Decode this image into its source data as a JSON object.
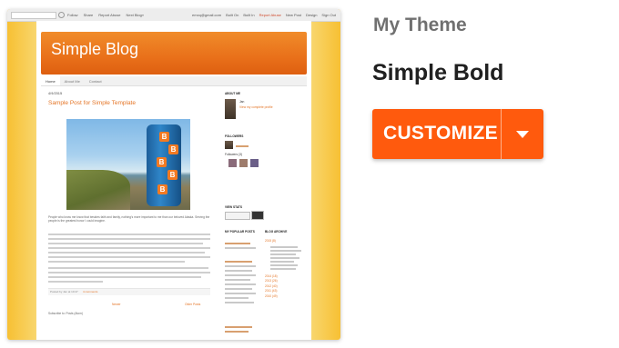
{
  "theme_panel": {
    "section_label": "My Theme",
    "theme_name": "Simple Bold",
    "customize_label": "CUSTOMIZE",
    "dropdown_icon": "caret-down-icon",
    "accent_color": "#ff5a0d"
  },
  "preview": {
    "navbar": {
      "links_left": [
        "Follow",
        "Share",
        "Report Abuse",
        "Next Blog»"
      ],
      "email": "emxq@gmail.com",
      "links_right": [
        "Built On",
        "Built In",
        "Report Abuse",
        "New Post",
        "Design",
        "Sign Out"
      ]
    },
    "blog_title": "Simple Blog",
    "tabs": [
      "Home",
      "About Me",
      "Contact"
    ],
    "post": {
      "date": "4/9/2015",
      "title": "Sample Post for Simple Template",
      "body_intro": "People who know me know that besides faith and family, nothing's more important to me than our beloved Alaska. Serving the people is the greatest honor I could imagine.",
      "posted_by": "Posted by Jan at 10:47",
      "comments": "4 comments",
      "newer": "Newer",
      "older": "Older Posts",
      "subscribe": "Subscribe to: Posts (Atom)"
    },
    "sidebar": {
      "about_heading": "ABOUT ME",
      "about_name": "Jan",
      "about_link": "View my complete profile",
      "followers_heading": "FOLLOWERS",
      "followers_label": "Followers (3)",
      "stats_heading": "VIEW STATS",
      "popular_heading": "MY POPULAR POSTS",
      "archive_heading": "BLOG ARCHIVE",
      "archive_years": [
        "2015 (8)",
        "2014 (18)",
        "2013 (26)",
        "2012 (40)",
        "2011 (43)",
        "2010 (49)"
      ]
    }
  }
}
